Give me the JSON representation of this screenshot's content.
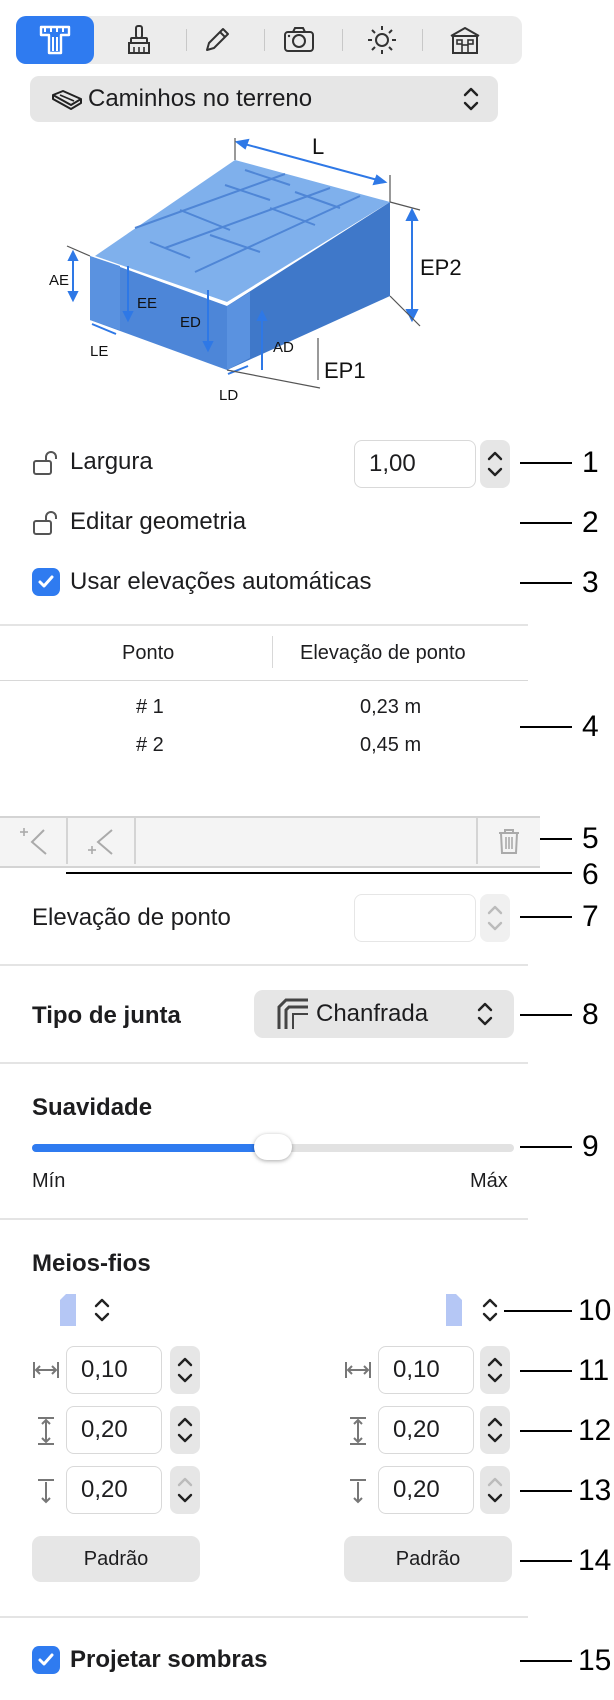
{
  "toolbar": {
    "icons": [
      "geometry-icon",
      "paint-brush-icon",
      "pencil-icon",
      "camera-icon",
      "sun-icon",
      "building-icon"
    ]
  },
  "type_popup": {
    "label": "Caminhos no terreno"
  },
  "diagram": {
    "labels": {
      "L": "L",
      "EP2": "EP2",
      "EP1": "EP1",
      "AE": "AE",
      "EE": "EE",
      "ED": "ED",
      "AD": "AD",
      "LE": "LE",
      "LD": "LD"
    }
  },
  "width_row": {
    "label": "Largura",
    "value": "1,00"
  },
  "edit_geometry": {
    "label": "Editar geometria"
  },
  "auto_elevations": {
    "label": "Usar elevações automáticas",
    "checked": true
  },
  "points_table": {
    "columns": [
      "Ponto",
      "Elevação de ponto"
    ],
    "rows": [
      {
        "point": "# 1",
        "elevation": "0,23 m"
      },
      {
        "point": "# 2",
        "elevation": "0,45 m"
      }
    ]
  },
  "point_elevation": {
    "label": "Elevação de ponto",
    "value": ""
  },
  "joint_type": {
    "label": "Tipo de junta",
    "value": "Chanfrada"
  },
  "smoothness": {
    "label": "Suavidade",
    "min_label": "Mín",
    "max_label": "Máx",
    "value": 0.5
  },
  "curbs": {
    "label": "Meios-fios",
    "left": {
      "width": "0,10",
      "height": "0,20",
      "depth": "0,20",
      "default_label": "Padrão"
    },
    "right": {
      "width": "0,10",
      "height": "0,20",
      "depth": "0,20",
      "default_label": "Padrão"
    }
  },
  "cast_shadows": {
    "label": "Projetar sombras",
    "checked": true
  },
  "callouts": [
    "1",
    "2",
    "3",
    "4",
    "5",
    "6",
    "7",
    "8",
    "9",
    "10",
    "11",
    "12",
    "13",
    "14",
    "15"
  ]
}
